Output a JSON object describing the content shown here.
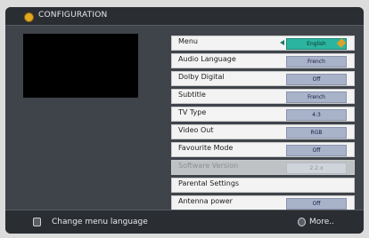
{
  "header": {
    "title": "CONFIGURATION"
  },
  "menu": {
    "items": [
      {
        "label": "Menu",
        "value": "English",
        "selected": true
      },
      {
        "label": "Audio Language",
        "value": "French"
      },
      {
        "label": "Dolby Digital",
        "value": "Off"
      },
      {
        "label": "Subtitle",
        "value": "French"
      },
      {
        "label": "TV Type",
        "value": "4:3"
      },
      {
        "label": "Video Out",
        "value": "RGB"
      },
      {
        "label": "Favourite Mode",
        "value": "Off"
      },
      {
        "label": "Software Version",
        "value": "2.2.x",
        "disabled": true
      },
      {
        "label": "Parental Settings",
        "value": ""
      },
      {
        "label": "Antenna power",
        "value": "Off"
      }
    ]
  },
  "footer": {
    "hint": "Change menu language",
    "more": "More.."
  },
  "colors": {
    "selected_value": "#2bb5a0",
    "value_box": "#a8b2c9",
    "row_bg": "#f3f3f3"
  }
}
